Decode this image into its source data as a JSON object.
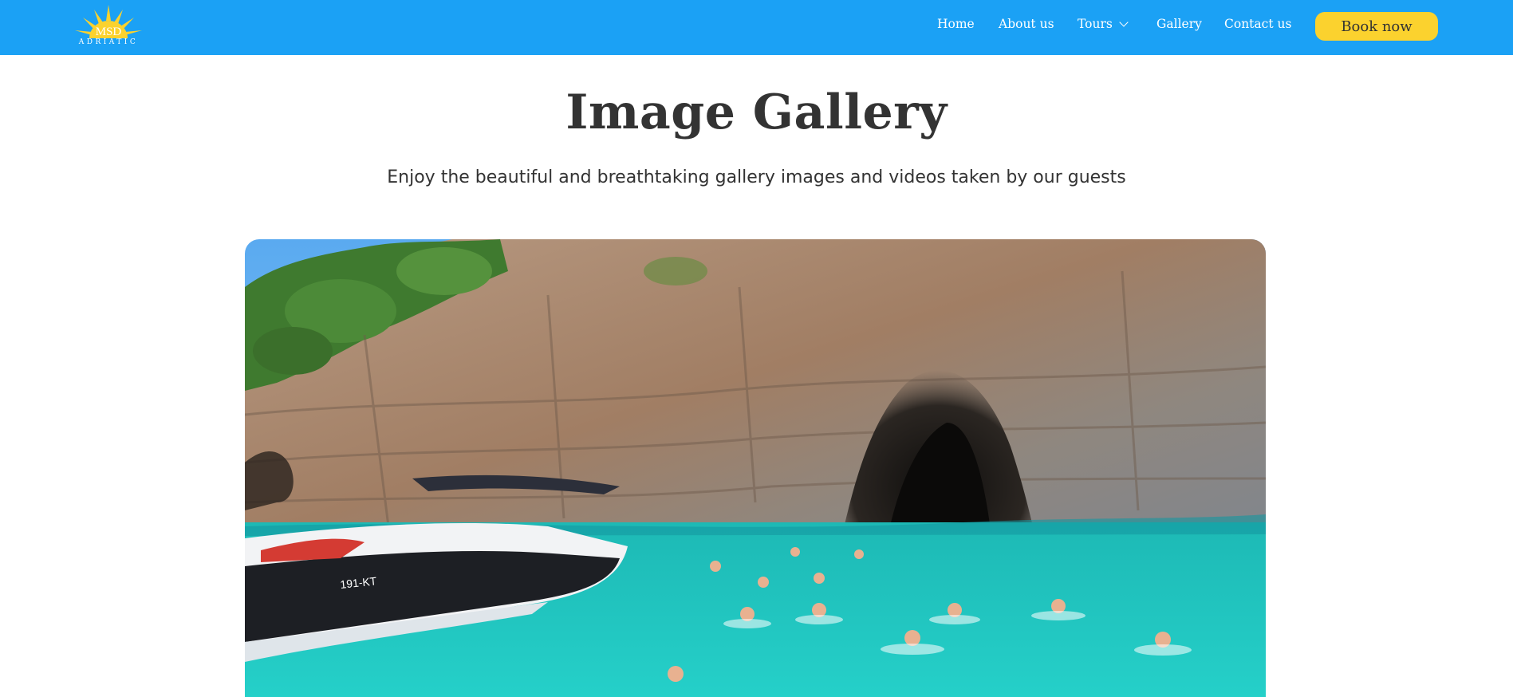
{
  "header": {
    "logo": {
      "brand_top": "MSD",
      "brand_bottom": "ADRIATIC",
      "icon": "sun-logo-icon"
    },
    "nav": [
      {
        "label": "Home"
      },
      {
        "label": "About us"
      },
      {
        "label": "Tours",
        "icon": "chevron-down-icon"
      },
      {
        "label": "Gallery"
      },
      {
        "label": "Contact us"
      }
    ],
    "cta_label": "Book now"
  },
  "main": {
    "title": "Image Gallery",
    "subtitle": "Enjoy the beautiful and breathtaking gallery images and videos taken by our guests",
    "image": {
      "boat_registration": "191-KT"
    }
  },
  "colors": {
    "navbar": "#1ba1f5",
    "cta": "#fbd22e",
    "text": "#333333",
    "water": "#1ec8c4",
    "rock": "#a88b74"
  }
}
